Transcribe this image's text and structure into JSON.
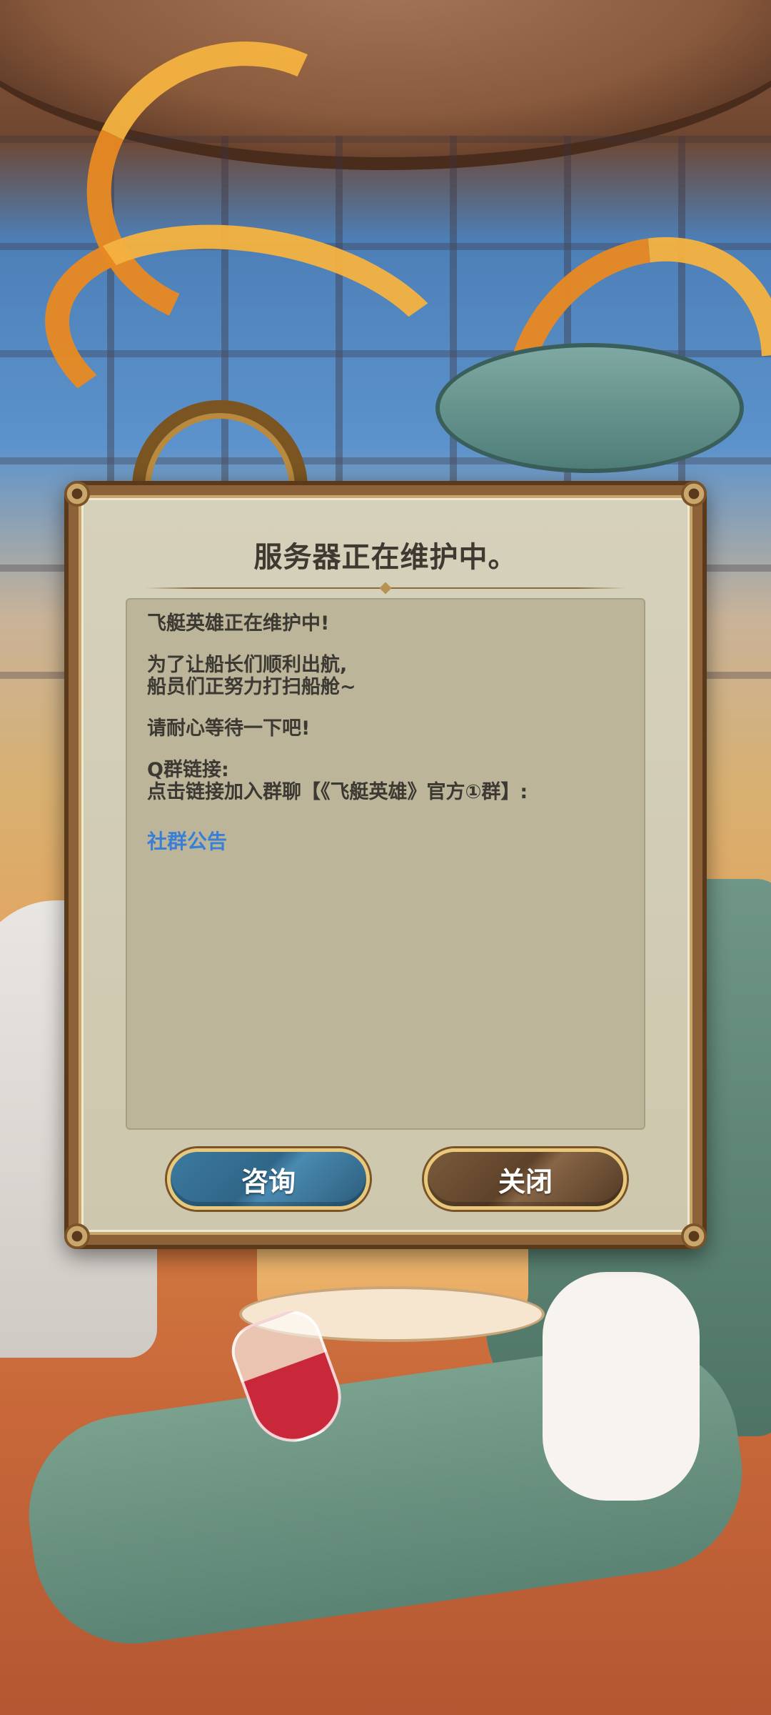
{
  "dialog": {
    "title": "服务器正在维护中。",
    "message": {
      "line1": "飞艇英雄正在维护中!",
      "line2": "为了让船长们顺利出航,",
      "line3": "船员们正努力打扫船舱~",
      "line4": "请耐心等待一下吧!",
      "line5": "Q群链接:",
      "line6": "点击链接加入群聊【《飞艇英雄》官方①群】:"
    },
    "link_label": "社群公告",
    "buttons": {
      "consult": "咨询",
      "close": "关闭"
    }
  },
  "colors": {
    "link": "#3a7fd6",
    "consult_button": "#2f6688",
    "close_button": "#5e4229",
    "panel": "#cdc7ad"
  }
}
